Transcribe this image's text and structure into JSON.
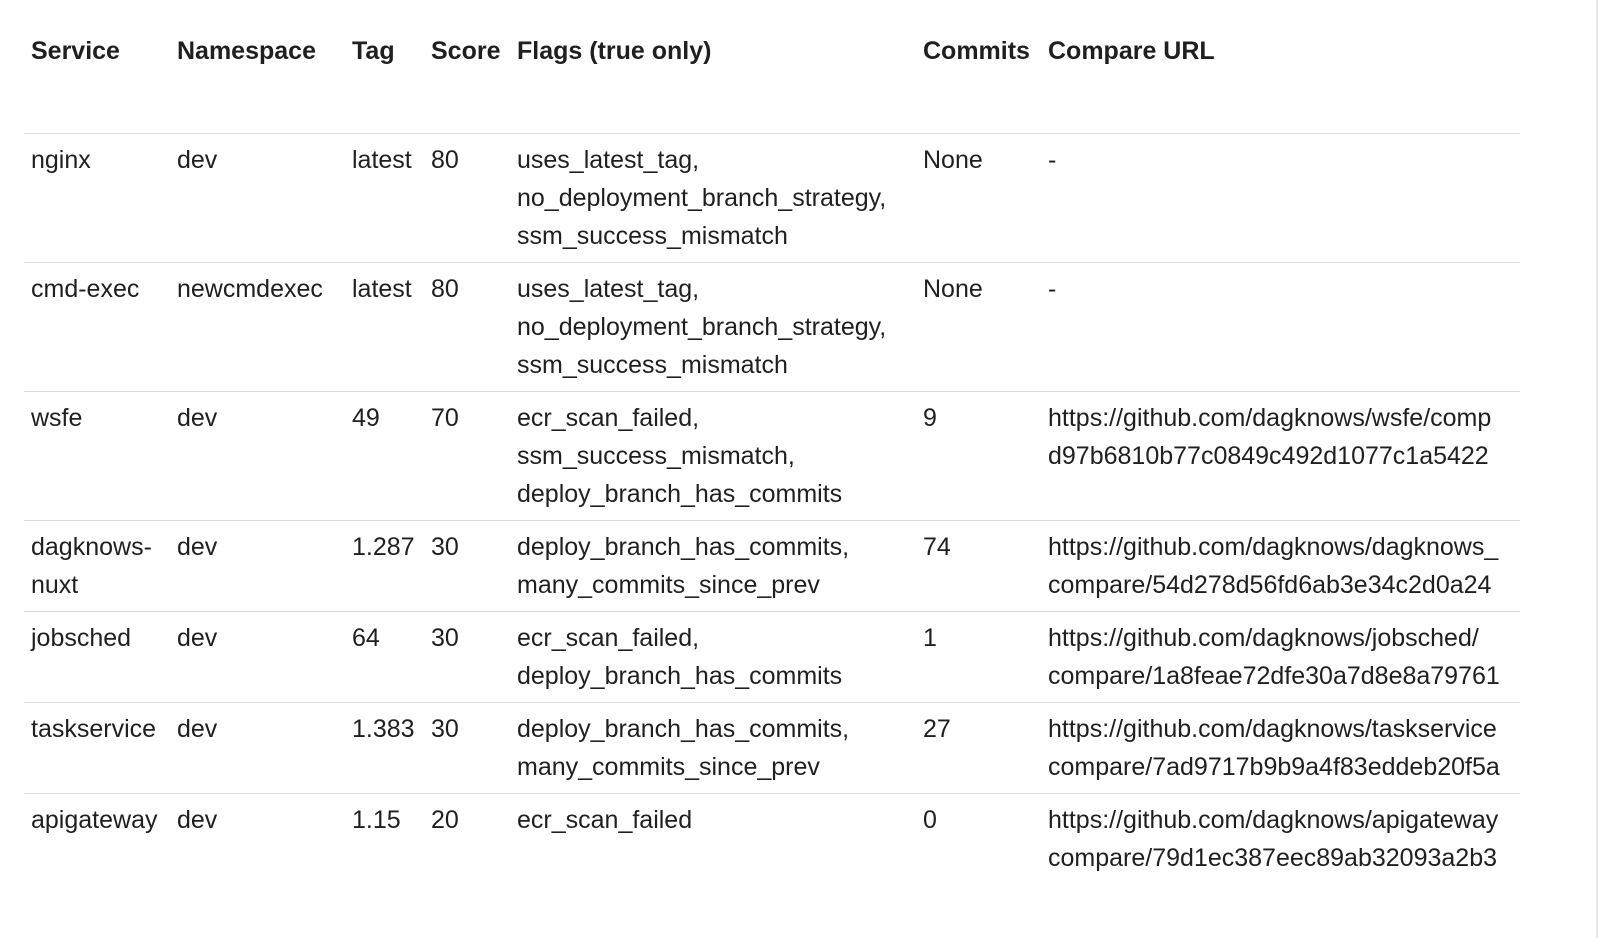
{
  "table": {
    "headers": [
      "Service",
      "Namespace",
      "Tag",
      "Score",
      "Flags (true only)",
      "Commits",
      "Compare URL"
    ],
    "rows": [
      {
        "service": "nginx",
        "namespace": "dev",
        "tag": "latest",
        "score": "80",
        "flags": [
          "uses_latest_tag,",
          "no_deployment_branch_strategy,",
          "ssm_success_mismatch"
        ],
        "commits": "None",
        "url": [
          "-"
        ]
      },
      {
        "service": "cmd-exec",
        "namespace": "newcmdexec",
        "tag": "latest",
        "score": "80",
        "flags": [
          "uses_latest_tag,",
          "no_deployment_branch_strategy,",
          "ssm_success_mismatch"
        ],
        "commits": "None",
        "url": [
          "-"
        ]
      },
      {
        "service": "wsfe",
        "namespace": "dev",
        "tag": "49",
        "score": "70",
        "flags": [
          "ecr_scan_failed,",
          "ssm_success_mismatch,",
          "deploy_branch_has_commits"
        ],
        "commits": "9",
        "url": [
          "https://github.com/dagknows/wsfe/comp",
          "d97b6810b77c0849c492d1077c1a5422"
        ]
      },
      {
        "service": "dagknows-nuxt",
        "namespace": "dev",
        "tag": "1.287",
        "score": "30",
        "flags": [
          "deploy_branch_has_commits,",
          "many_commits_since_prev"
        ],
        "commits": "74",
        "url": [
          "https://github.com/dagknows/dagknows_",
          "compare/54d278d56fd6ab3e34c2d0a24"
        ]
      },
      {
        "service": "jobsched",
        "namespace": "dev",
        "tag": "64",
        "score": "30",
        "flags": [
          "ecr_scan_failed,",
          "deploy_branch_has_commits"
        ],
        "commits": "1",
        "url": [
          "https://github.com/dagknows/jobsched/",
          "compare/1a8feae72dfe30a7d8e8a79761"
        ]
      },
      {
        "service": "taskservice",
        "namespace": "dev",
        "tag": "1.383",
        "score": "30",
        "flags": [
          "deploy_branch_has_commits,",
          "many_commits_since_prev"
        ],
        "commits": "27",
        "url": [
          "https://github.com/dagknows/taskservice",
          "compare/7ad9717b9b9a4f83eddeb20f5a"
        ]
      },
      {
        "service": "apigateway",
        "namespace": "dev",
        "tag": "1.15",
        "score": "20",
        "flags": [
          "ecr_scan_failed"
        ],
        "commits": "0",
        "url": [
          "https://github.com/dagknows/apigateway",
          "compare/79d1ec387eec89ab32093a2b3"
        ]
      }
    ]
  }
}
